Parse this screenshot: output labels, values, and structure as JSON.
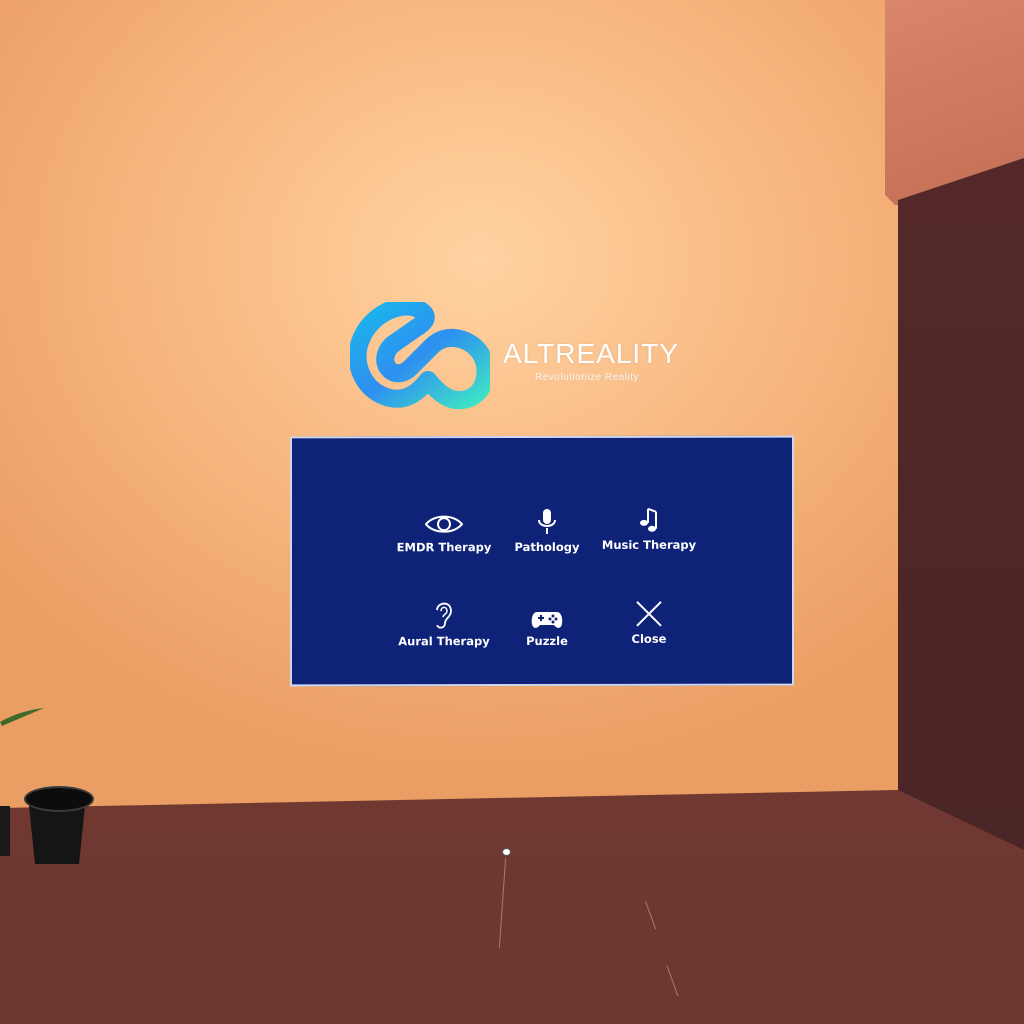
{
  "brand": {
    "name": "ALTREALITY",
    "tagline": "Revolutionize Reality"
  },
  "menu": {
    "items": [
      {
        "label": "EMDR Therapy",
        "icon": "eye-icon"
      },
      {
        "label": "Pathology",
        "icon": "microphone-icon"
      },
      {
        "label": "Music Therapy",
        "icon": "music-note-icon"
      },
      {
        "label": "Aural Therapy",
        "icon": "ear-icon"
      },
      {
        "label": "Puzzle",
        "icon": "gamepad-icon"
      },
      {
        "label": "Close",
        "icon": "close-icon"
      }
    ]
  },
  "colors": {
    "panel_background": "#0e2278",
    "wall": "#f7b57d",
    "floor": "#743a32",
    "logo_gradient_start": "#1ec8e6",
    "logo_gradient_end": "#3fe0c8"
  }
}
